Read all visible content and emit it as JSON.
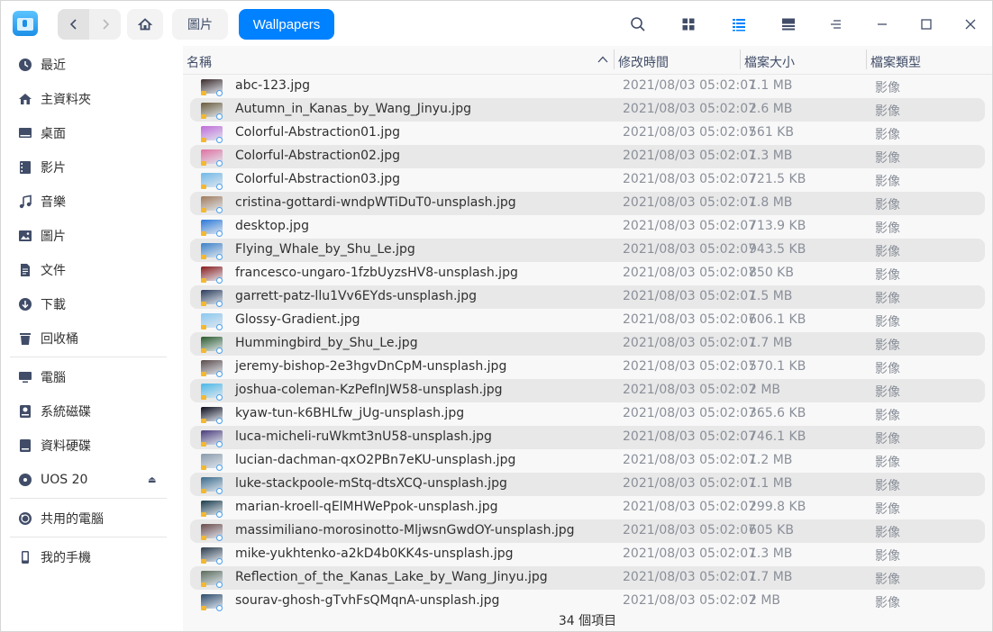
{
  "breadcrumb": {
    "pictures": "圖片",
    "current": "Wallpapers"
  },
  "sidebar": {
    "items": [
      {
        "label": "最近",
        "icon": "clock-icon"
      },
      {
        "label": "主資料夾",
        "icon": "home-icon"
      },
      {
        "label": "桌面",
        "icon": "desktop-icon"
      },
      {
        "label": "影片",
        "icon": "video-icon"
      },
      {
        "label": "音樂",
        "icon": "music-icon"
      },
      {
        "label": "圖片",
        "icon": "picture-icon"
      },
      {
        "label": "文件",
        "icon": "document-icon"
      },
      {
        "label": "下載",
        "icon": "download-icon"
      },
      {
        "label": "回收桶",
        "icon": "trash-icon"
      },
      {
        "label": "電腦",
        "icon": "computer-icon"
      },
      {
        "label": "系統磁碟",
        "icon": "system-disk-icon"
      },
      {
        "label": "資料硬碟",
        "icon": "data-disk-icon"
      },
      {
        "label": "UOS 20",
        "icon": "disc-icon"
      },
      {
        "label": "共用的電腦",
        "icon": "network-icon"
      },
      {
        "label": "我的手機",
        "icon": "phone-icon"
      }
    ]
  },
  "columns": {
    "name": "名稱",
    "modified": "修改時間",
    "size": "檔案大小",
    "type": "檔案類型"
  },
  "files": [
    {
      "name": "abc-123.jpg",
      "date": "2021/08/03 05:02:07",
      "size": "1.1 MB",
      "type": "影像",
      "thumb": "#3a2a2a"
    },
    {
      "name": "Autumn_in_Kanas_by_Wang_Jinyu.jpg",
      "date": "2021/08/03 05:02:07",
      "size": "2.6 MB",
      "type": "影像",
      "thumb": "#6a5a3a"
    },
    {
      "name": "Colorful-Abstraction01.jpg",
      "date": "2021/08/03 05:02:07",
      "size": "561 KB",
      "type": "影像",
      "thumb": "#c06ad8"
    },
    {
      "name": "Colorful-Abstraction02.jpg",
      "date": "2021/08/03 05:02:07",
      "size": "1.3 MB",
      "type": "影像",
      "thumb": "#e070a0"
    },
    {
      "name": "Colorful-Abstraction03.jpg",
      "date": "2021/08/03 05:02:07",
      "size": "721.5 KB",
      "type": "影像",
      "thumb": "#70b8e8"
    },
    {
      "name": "cristina-gottardi-wndpWTiDuT0-unsplash.jpg",
      "date": "2021/08/03 05:02:07",
      "size": "1.8 MB",
      "type": "影像",
      "thumb": "#a07a5a"
    },
    {
      "name": "desktop.jpg",
      "date": "2021/08/03 05:02:07",
      "size": "713.9 KB",
      "type": "影像",
      "thumb": "#2a78d8"
    },
    {
      "name": "Flying_Whale_by_Shu_Le.jpg",
      "date": "2021/08/03 05:02:07",
      "size": "943.5 KB",
      "type": "影像",
      "thumb": "#3a80c8"
    },
    {
      "name": "francesco-ungaro-1fzbUyzsHV8-unsplash.jpg",
      "date": "2021/08/03 05:02:07",
      "size": "850 KB",
      "type": "影像",
      "thumb": "#8a1a1a"
    },
    {
      "name": "garrett-patz-llu1Vv6EYds-unsplash.jpg",
      "date": "2021/08/03 05:02:07",
      "size": "1.5 MB",
      "type": "影像",
      "thumb": "#2a3a5a"
    },
    {
      "name": "Glossy-Gradient.jpg",
      "date": "2021/08/03 05:02:07",
      "size": "606.1 KB",
      "type": "影像",
      "thumb": "#8ac8f0"
    },
    {
      "name": "Hummingbird_by_Shu_Le.jpg",
      "date": "2021/08/03 05:02:07",
      "size": "1.7 MB",
      "type": "影像",
      "thumb": "#2a5a2a"
    },
    {
      "name": "jeremy-bishop-2e3hgvDnCpM-unsplash.jpg",
      "date": "2021/08/03 05:02:07",
      "size": "570.1 KB",
      "type": "影像",
      "thumb": "#5a4a4a"
    },
    {
      "name": "joshua-coleman-KzPefInJW58-unsplash.jpg",
      "date": "2021/08/03 05:02:07",
      "size": "2 MB",
      "type": "影像",
      "thumb": "#4ab8e8"
    },
    {
      "name": "kyaw-tun-k6BHLfw_jUg-unsplash.jpg",
      "date": "2021/08/03 05:02:07",
      "size": "365.6 KB",
      "type": "影像",
      "thumb": "#0a0a1a"
    },
    {
      "name": "luca-micheli-ruWkmt3nU58-unsplash.jpg",
      "date": "2021/08/03 05:02:07",
      "size": "746.1 KB",
      "type": "影像",
      "thumb": "#4a3a7a"
    },
    {
      "name": "lucian-dachman-qxO2PBn7eKU-unsplash.jpg",
      "date": "2021/08/03 05:02:07",
      "size": "1.2 MB",
      "type": "影像",
      "thumb": "#8a9aaa"
    },
    {
      "name": "luke-stackpoole-mStq-dtsXCQ-unsplash.jpg",
      "date": "2021/08/03 05:02:07",
      "size": "1.1 MB",
      "type": "影像",
      "thumb": "#3a6a8a"
    },
    {
      "name": "marian-kroell-qElMHWePpok-unsplash.jpg",
      "date": "2021/08/03 05:02:07",
      "size": "299.8 KB",
      "type": "影像",
      "thumb": "#1a3a4a"
    },
    {
      "name": "massimiliano-morosinotto-MljwsnGwdOY-unsplash.jpg",
      "date": "2021/08/03 05:02:07",
      "size": "605 KB",
      "type": "影像",
      "thumb": "#6a4a4a"
    },
    {
      "name": "mike-yukhtenko-a2kD4b0KK4s-unsplash.jpg",
      "date": "2021/08/03 05:02:07",
      "size": "1.3 MB",
      "type": "影像",
      "thumb": "#2a3a4a"
    },
    {
      "name": "Reflection_of_the_Kanas_Lake_by_Wang_Jinyu.jpg",
      "date": "2021/08/03 05:02:07",
      "size": "1.7 MB",
      "type": "影像",
      "thumb": "#5a6a5a"
    },
    {
      "name": "sourav-ghosh-gTvhFsQMqnA-unsplash.jpg",
      "date": "2021/08/03 05:02:07",
      "size": "2 MB",
      "type": "影像",
      "thumb": "#2a4a6a"
    }
  ],
  "status": "34 個項目",
  "colors": {
    "accent": "#0081ff",
    "row_alt": "#e8e8e8",
    "main_bg": "#f8f8f8"
  }
}
